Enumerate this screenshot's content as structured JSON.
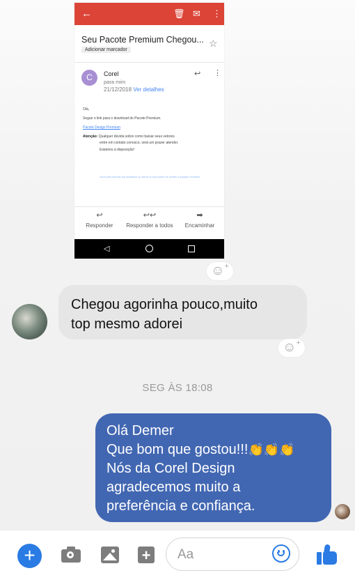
{
  "email_screenshot": {
    "subject": "Seu Pacote Premium Chegou...",
    "label_chip": "Adicionar marcador",
    "sender_initial": "C",
    "sender": "Corel",
    "to": "para mim",
    "date": "21/12/2018",
    "details_link": "Ver detalhes",
    "body": {
      "greeting": "Olá,",
      "line1": "Segue o link para o download do Pacote Premium.",
      "link": "Pacote Design Premium",
      "attention_label": "Atenção:",
      "attention_text": "Qualquer dúvida sobre como baixar seus vetores",
      "attention_text2": "entre em contato conosco, será um prazer atender.",
      "closing": "Estamos à disposição!",
      "footer": "Você pode cancelar sua assinatura ou alterar os seus dados de contato a qualquer momento."
    },
    "actions": [
      {
        "icon": "reply-icon",
        "label": "Responder"
      },
      {
        "icon": "reply-all-icon",
        "label": "Responder a todos"
      },
      {
        "icon": "forward-icon",
        "label": "Encaminhar"
      }
    ],
    "toolbar_icons": [
      "back-arrow-icon",
      "trash-icon",
      "mail-icon",
      "more-vert-icon"
    ],
    "accent_color": "#db4437"
  },
  "messages": {
    "incoming_line1": "Chegou agorinha pouco,muito",
    "incoming_line2": "top mesmo adorei",
    "timestamp": "SEG ÀS 18:08",
    "outgoing_lines": [
      "Olá Demer",
      "Que bom que gostou!!!",
      "Nós da Corel Design",
      "agradecemos muito a",
      "preferência e confiança."
    ],
    "clap_emojis": "👏👏👏",
    "outgoing_color": "#4267b2",
    "incoming_color": "#e6e6e6"
  },
  "composer": {
    "placeholder": "Aa",
    "icons": [
      "plus-icon",
      "camera-icon",
      "image-icon",
      "sticker-icon",
      "emoji-icon",
      "like-icon"
    ],
    "accent_color": "#2a7be4"
  }
}
